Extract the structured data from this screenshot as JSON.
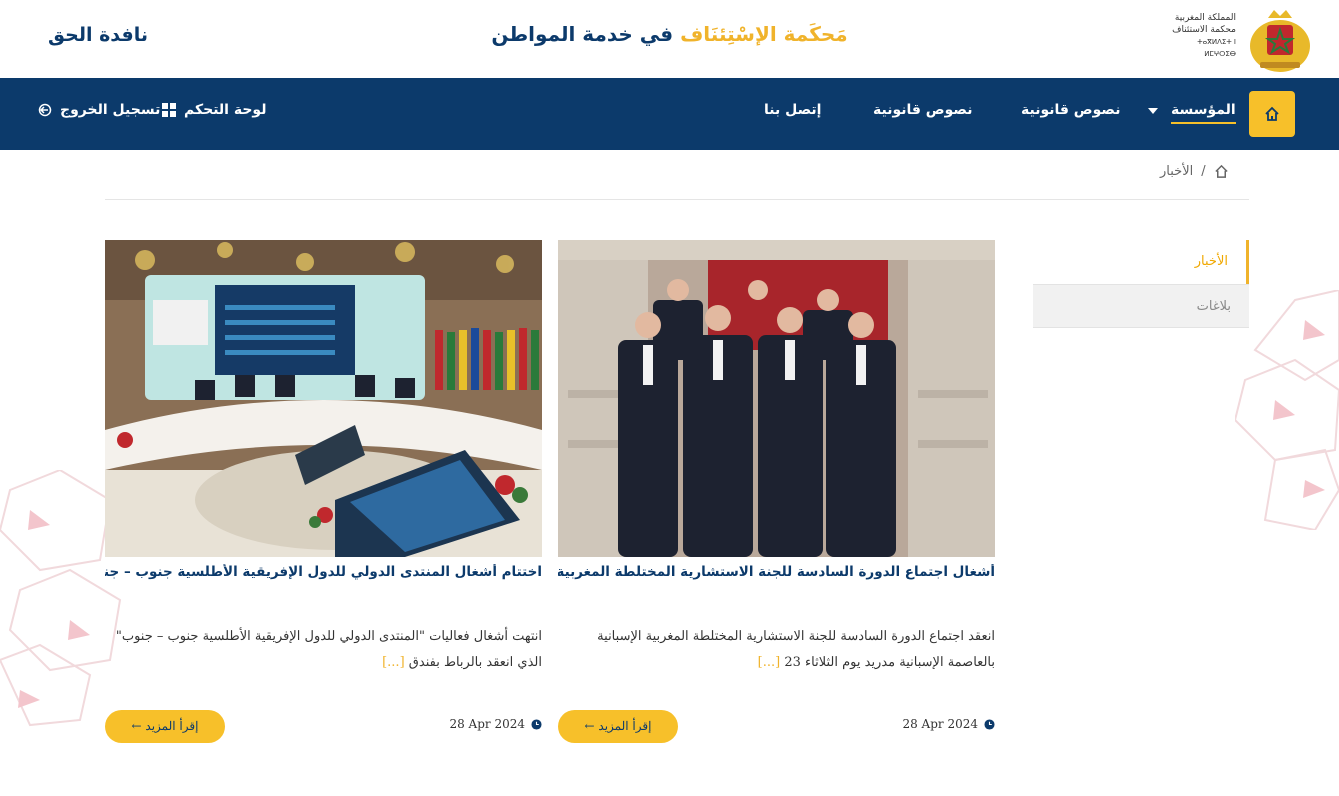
{
  "header": {
    "brand": "نافدة الحق",
    "title_part1": "مَحكَمة الإسْتِئنَاف",
    "title_part2": "في خدمة المواطن",
    "emblem_text": [
      "المملكة المغربية",
      "محكمة الاستئناف",
      "ⵜⴰⴳⵍⴷⵉⵜ ⵏ ⵍⵎⵖⵔⵉⴱ"
    ],
    "colors": {
      "navy": "#0c3a6b",
      "gold": "#f0b32b"
    }
  },
  "nav": {
    "home_icon": "home-icon",
    "items": [
      "المؤسسة",
      "نصوص قانونية",
      "نصوص قانونية",
      "إتصل بنا"
    ],
    "dashboard": "لوحة التحكم",
    "logout": "تسجيل الخروج"
  },
  "breadcrumb": {
    "current": "الأخبار"
  },
  "sidebar": {
    "items": [
      "الأخبار",
      "بلاغات"
    ]
  },
  "articles": [
    {
      "title": "أشغال اجتماع الدورة السادسة للجنة الاستشارية المختلطة المغربية الإسبانية",
      "excerpt": "انعقد اجتماع الدورة السادسة للجنة الاستشارية المختلطة المغربية الإسبانية بالعاصمة الإسبانية مدريد يوم الثلاثاء 23",
      "more": "[...]",
      "date": "28 Apr 2024",
      "button": "إقرأ المزيد ←"
    },
    {
      "title": "اختتام أشغال المنتدى الدولي للدول الإفريقية الأطلسية جنوب – جنوب",
      "excerpt": "انتهت أشغال فعاليات \"المنتدى الدولي للدول الإفريقية الأطلسية جنوب – جنوب\" الذي انعقد بالرباط بفندق",
      "more": "[...]",
      "date": "28 Apr 2024",
      "button": "إقرأ المزيد ←"
    }
  ]
}
